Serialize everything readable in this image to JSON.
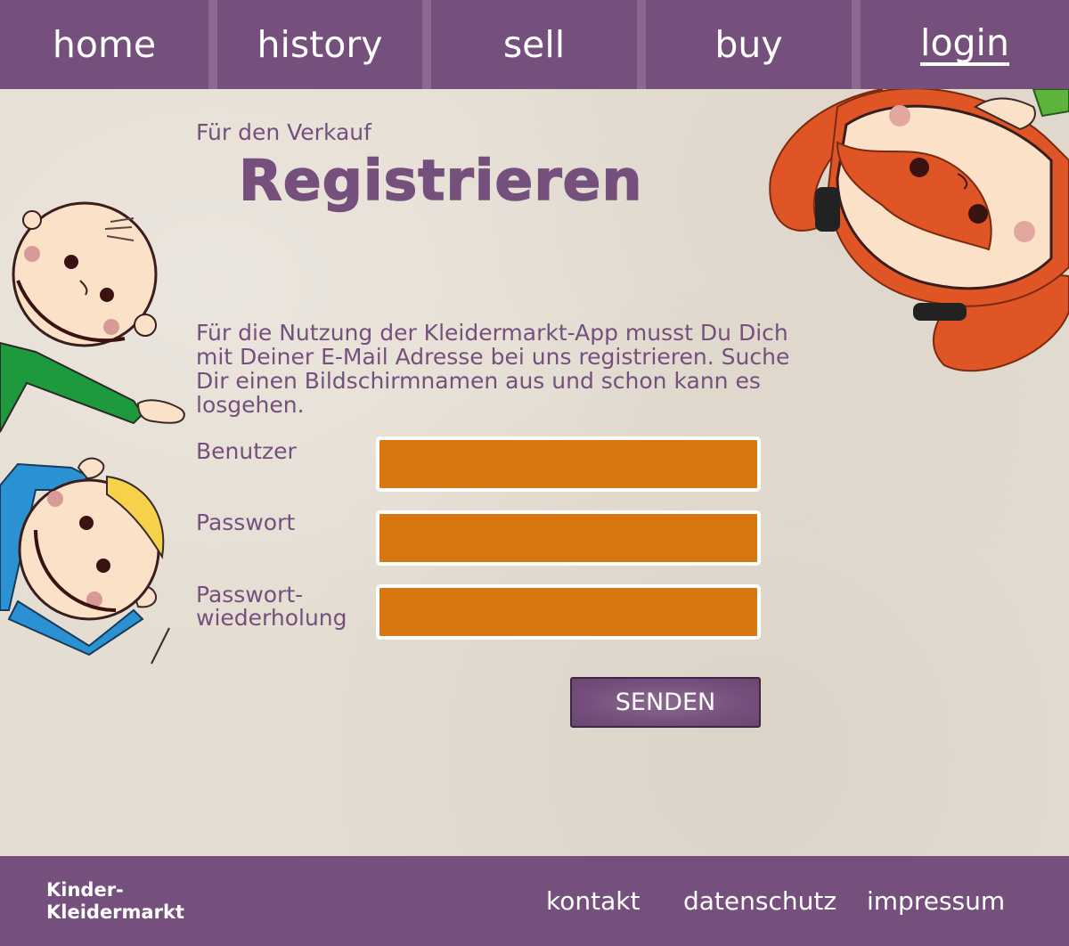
{
  "nav": {
    "items": [
      {
        "label": "home",
        "active": false
      },
      {
        "label": "history",
        "active": false
      },
      {
        "label": "sell",
        "active": false
      },
      {
        "label": "buy",
        "active": false
      },
      {
        "label": "login",
        "active": true
      }
    ]
  },
  "header": {
    "subtitle": "Für den Verkauf",
    "title": "Registrieren"
  },
  "intro": "Für die Nutzung der Kleidermarkt-App musst Du Dich mit Deiner E-Mail Adresse bei uns registrieren. Suche Dir einen Bildschirmnamen aus und schon kann es losgehen.",
  "form": {
    "user_label": "Benutzer",
    "user_value": "",
    "password_label": "Passwort",
    "password_value": "",
    "password_repeat_label_line1": "Passwort-",
    "password_repeat_label_line2": "wiederholung",
    "password_repeat_value": "",
    "submit_label": "SENDEN"
  },
  "footer": {
    "logo_line1": "Kinder-",
    "logo_line2": "Kleidermarkt",
    "links": [
      "kontakt",
      "datenschutz",
      "impressum"
    ]
  },
  "colors": {
    "primary": "#76507d",
    "input": "#d87710",
    "background": "#e4ddd2"
  }
}
